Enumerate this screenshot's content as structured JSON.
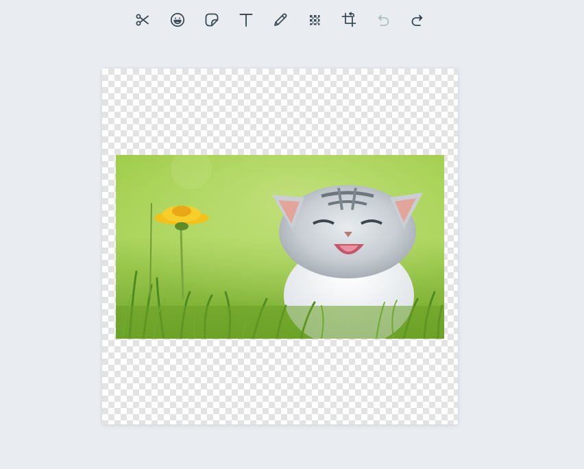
{
  "toolbar": {
    "tools": [
      {
        "id": "cut",
        "icon": "scissors-icon"
      },
      {
        "id": "emoji",
        "icon": "smiley-icon"
      },
      {
        "id": "sticker",
        "icon": "sticker-icon"
      },
      {
        "id": "text",
        "icon": "text-icon"
      },
      {
        "id": "draw",
        "icon": "pencil-icon"
      },
      {
        "id": "blur",
        "icon": "pixelate-icon"
      },
      {
        "id": "crop",
        "icon": "crop-icon"
      },
      {
        "id": "undo",
        "icon": "undo-icon",
        "disabled": true
      },
      {
        "id": "redo",
        "icon": "redo-icon"
      }
    ]
  },
  "canvas": {
    "background": "transparent-checkerboard"
  },
  "colors": {
    "page_bg": "#e9edf1",
    "icon": "#3b4a54",
    "icon_disabled": "#8696a0"
  }
}
